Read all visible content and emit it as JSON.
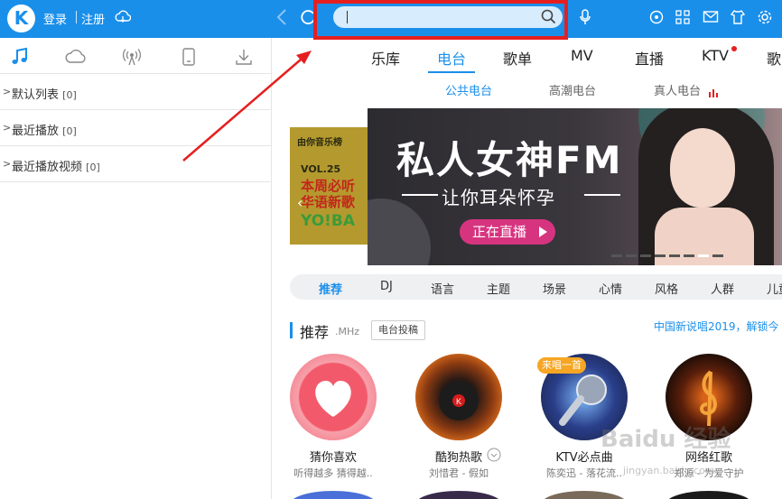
{
  "topbar": {
    "logo": "K",
    "login": "登录",
    "register": "注册"
  },
  "search": {
    "value": "",
    "placeholder": ""
  },
  "sidebar": {
    "tabs": [
      "music-icon",
      "cloud-icon",
      "radio-icon",
      "device-icon",
      "download-icon"
    ],
    "lists": [
      {
        "label": "默认列表",
        "count": "[0]"
      },
      {
        "label": "最近播放",
        "count": "[0]"
      },
      {
        "label": "最近播放视频",
        "count": "[0]"
      }
    ]
  },
  "nav": {
    "items": [
      "乐库",
      "电台",
      "歌单",
      "MV",
      "直播",
      "KTV",
      "歌"
    ],
    "active": "电台"
  },
  "subnav": {
    "items": [
      "公共电台",
      "高潮电台",
      "真人电台"
    ],
    "active": "公共电台"
  },
  "banner_prev": {
    "brand": "由你音乐榜",
    "vol": "VOL.25",
    "line1": "本周必听",
    "line2": "华语新歌",
    "line3": "YO!BA"
  },
  "banner": {
    "title": "私人女神FM",
    "subtitle": "让你耳朵怀孕",
    "button": "正在直播"
  },
  "categories": {
    "items": [
      "推荐",
      "DJ",
      "语言",
      "主题",
      "场景",
      "心情",
      "风格",
      "人群",
      "儿童"
    ],
    "active": "推荐"
  },
  "section": {
    "title": "推荐",
    "unit": ".MHz",
    "button": "电台投稿",
    "news": "中国新说唱2019，解锁今"
  },
  "stations": [
    {
      "name": "猜你喜欢",
      "desc": "听得越多 猜得越..",
      "badge": ""
    },
    {
      "name": "酷狗热歌",
      "desc": "刘惜君 - 假如",
      "badge": ""
    },
    {
      "name": "KTV必点曲",
      "desc": "陈奕迅 - 落花流..",
      "badge": "来唱一首"
    },
    {
      "name": "网络红歌",
      "desc": "郑源 - 为爱守护",
      "badge": ""
    }
  ],
  "watermark": {
    "brand": "Baidu 经验",
    "url": "jingyan.baidu.com"
  },
  "colors": {
    "brand": "#1a8fea",
    "annotation": "#e51f1f",
    "live": "#d7347f"
  }
}
